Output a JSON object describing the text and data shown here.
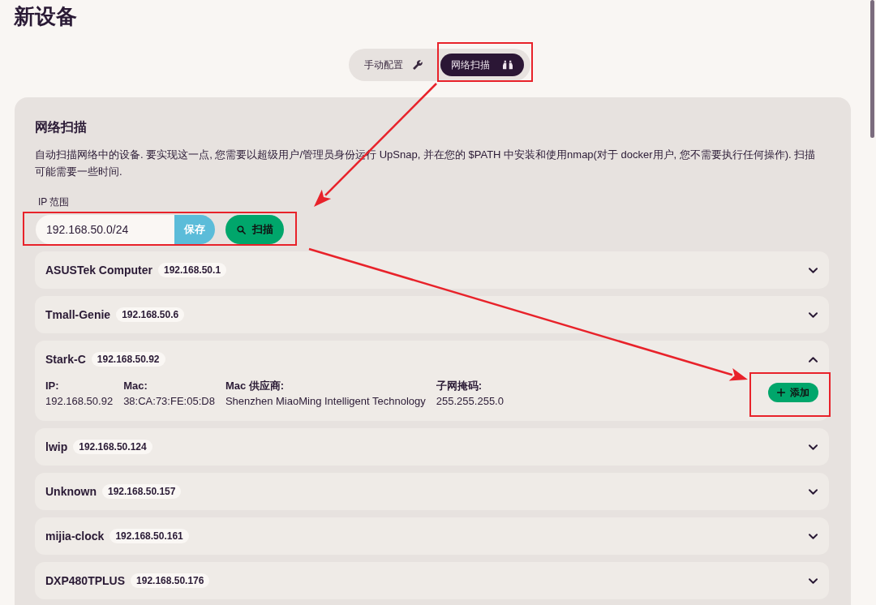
{
  "page": {
    "title": "新设备"
  },
  "mode_tabs": [
    {
      "kind": "manual",
      "label": "手动配置",
      "selected": false
    },
    {
      "kind": "scan",
      "label": "网络扫描",
      "selected": true
    }
  ],
  "scan_panel": {
    "title": "网络扫描",
    "description": "自动扫描网络中的设备. 要实现这一点, 您需要以超级用户/管理员身份运行 UpSnap, 并在您的 $PATH 中安装和使用nmap(对于 docker用户, 您不需要执行任何操作). 扫描可能需要一些时间.",
    "ip_range": {
      "label": "IP 范围",
      "value": "192.168.50.0/24",
      "save_button": "保存",
      "scan_button": "扫描"
    }
  },
  "devices": [
    {
      "name": "ASUSTek Computer",
      "ip": "192.168.50.1",
      "expanded": false
    },
    {
      "name": "Tmall-Genie",
      "ip": "192.168.50.6",
      "expanded": false
    },
    {
      "name": "Stark-C",
      "ip": "192.168.50.92",
      "expanded": true,
      "details": [
        {
          "label": "IP:",
          "value": "192.168.50.92"
        },
        {
          "label": "Mac:",
          "value": "38:CA:73:FE:05:D8"
        },
        {
          "label": "Mac 供应商:",
          "value": "Shenzhen MiaoMing Intelligent Technology"
        },
        {
          "label": "子网掩码:",
          "value": "255.255.255.0"
        }
      ],
      "add_button": "添加"
    },
    {
      "name": "lwip",
      "ip": "192.168.50.124",
      "expanded": false
    },
    {
      "name": "Unknown",
      "ip": "192.168.50.157",
      "expanded": false
    },
    {
      "name": "mijia-clock",
      "ip": "192.168.50.161",
      "expanded": false
    },
    {
      "name": "DXP480TPLUS",
      "ip": "192.168.50.176",
      "expanded": false
    }
  ]
}
